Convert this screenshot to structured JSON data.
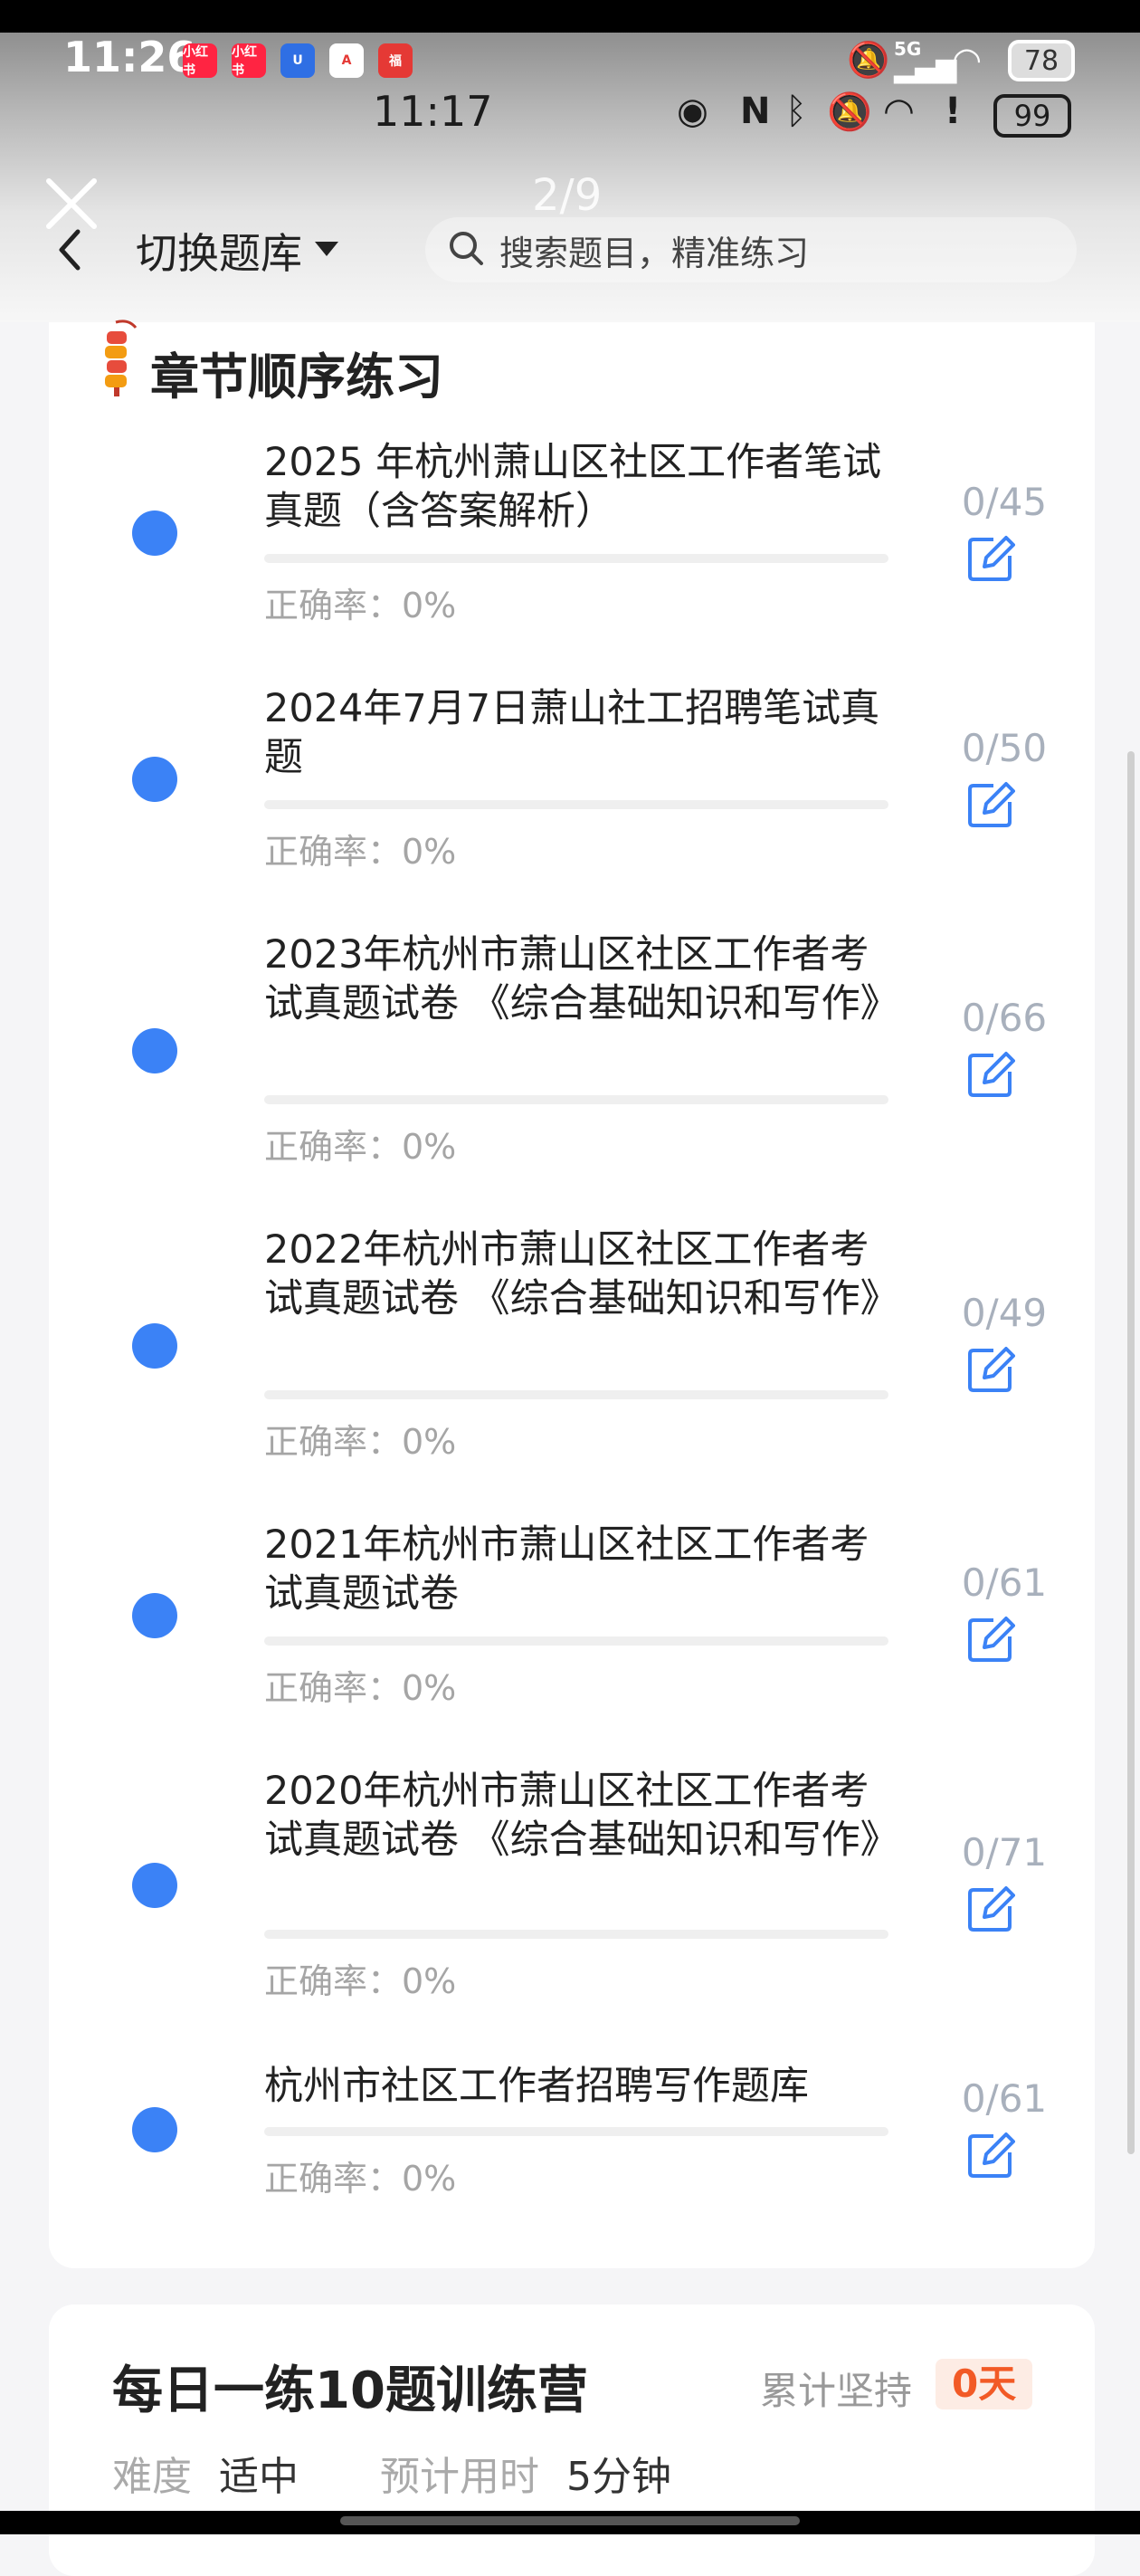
{
  "status_bar": {
    "time": "11:26",
    "network": "5G",
    "battery": "78",
    "app_icons": [
      "小红书",
      "小红书",
      "U",
      "A",
      "福"
    ]
  },
  "inner_status": {
    "time": "11:17",
    "battery": "99"
  },
  "overlay": {
    "pager": "2/9"
  },
  "nav": {
    "switch_bank_label": "切换题库",
    "search_placeholder": "搜索题目，精准练习"
  },
  "section": {
    "title": "章节顺序练习"
  },
  "chapters": [
    {
      "title": "2025 年杭州萧山区社区工作者笔试真题（含答案解析）",
      "count": "0/45",
      "accuracy": "正确率：0%"
    },
    {
      "title": "2024年7月7日萧山社工招聘笔试真题",
      "count": "0/50",
      "accuracy": "正确率：0%"
    },
    {
      "title": "2023年杭州市萧山区社区工作者考试真题试卷 《综合基础知识和写作》",
      "count": "0/66",
      "accuracy": "正确率：0%"
    },
    {
      "title": "2022年杭州市萧山区社区工作者考试真题试卷 《综合基础知识和写作》",
      "count": "0/49",
      "accuracy": "正确率：0%"
    },
    {
      "title": "2021年杭州市萧山区社区工作者考试真题试卷",
      "count": "0/61",
      "accuracy": "正确率：0%"
    },
    {
      "title": "2020年杭州市萧山区社区工作者考试真题试卷 《综合基础知识和写作》",
      "count": "0/71",
      "accuracy": "正确率：0%"
    },
    {
      "title": "杭州市社区工作者招聘写作题库",
      "count": "0/61",
      "accuracy": "正确率：0%"
    }
  ],
  "daily": {
    "title": "每日一练10题训练营",
    "persist_label": "累计坚持",
    "persist_value": "0天",
    "difficulty_label": "难度",
    "difficulty_value": "适中",
    "time_label": "预计用时",
    "time_value": "5分钟"
  },
  "colors": {
    "accent": "#3b82f6",
    "badge_text": "#f25a26",
    "badge_bg": "#fdece4"
  }
}
